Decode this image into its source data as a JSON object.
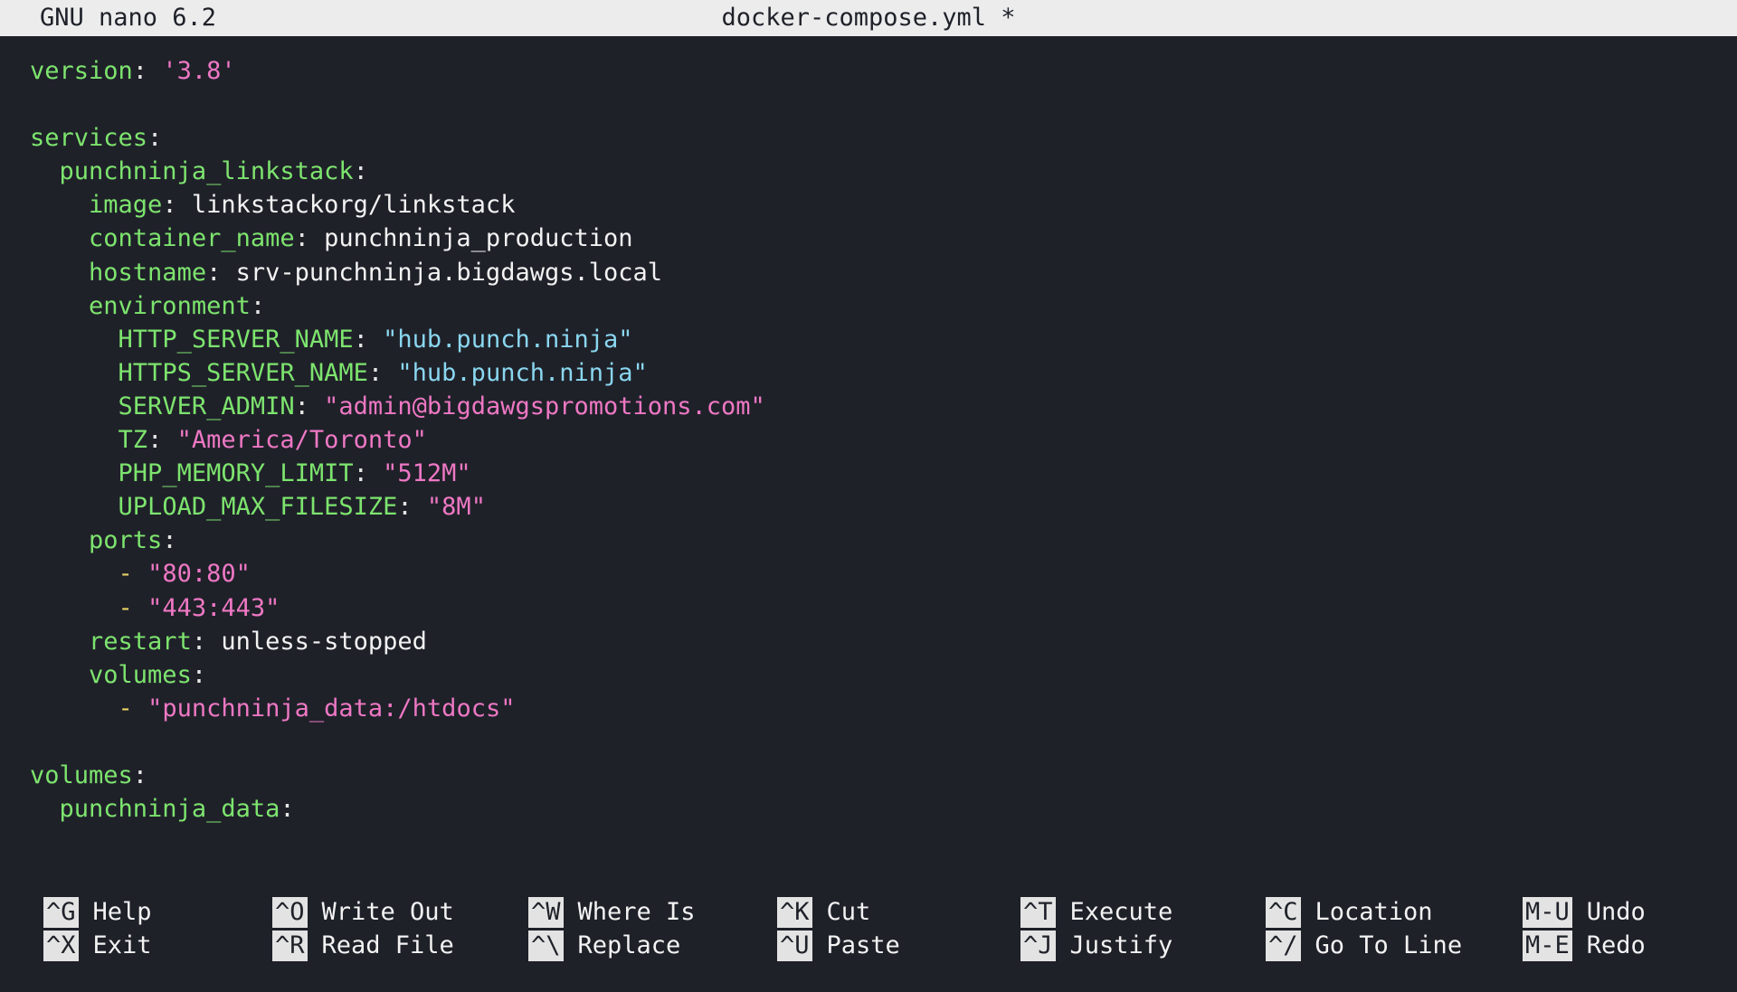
{
  "titlebar": {
    "app": "GNU nano 6.2",
    "filename": "docker-compose.yml *"
  },
  "colors": {
    "background": "#1f2129",
    "key": "#7de46e",
    "string": "#ee78c4",
    "string_alt": "#8ad7f0",
    "dash": "#e8d064",
    "titlebar_bg": "#ececed"
  },
  "editor": {
    "version_key": "version",
    "version_value": "'3.8'",
    "services_key": "services",
    "service_name": "punchninja_linkstack",
    "image_key": "image",
    "image_value": "linkstackorg/linkstack",
    "container_name_key": "container_name",
    "container_name_value": "punchninja_production",
    "hostname_key": "hostname",
    "hostname_value": "srv-punchninja.bigdawgs.local",
    "environment_key": "environment",
    "env": {
      "http_server_name_key": "HTTP_SERVER_NAME",
      "http_server_name_value": "\"hub.punch.ninja\"",
      "https_server_name_key": "HTTPS_SERVER_NAME",
      "https_server_name_value": "\"hub.punch.ninja\"",
      "server_admin_key": "SERVER_ADMIN",
      "server_admin_value": "\"admin@bigdawgspromotions.com\"",
      "tz_key": "TZ",
      "tz_value": "\"America/Toronto\"",
      "php_memory_limit_key": "PHP_MEMORY_LIMIT",
      "php_memory_limit_value": "\"512M\"",
      "upload_max_filesize_key": "UPLOAD_MAX_FILESIZE",
      "upload_max_filesize_value": "\"8M\""
    },
    "ports_key": "ports",
    "port_1": "\"80:80\"",
    "port_2": "\"443:443\"",
    "restart_key": "restart",
    "restart_value": "unless-stopped",
    "volumes_key": "volumes",
    "volume_mount": "\"punchninja_data:/htdocs\"",
    "top_volumes_key": "volumes",
    "volume_name": "punchninja_data"
  },
  "shortcuts": [
    {
      "key": "^G",
      "label": "Help"
    },
    {
      "key": "^X",
      "label": "Exit"
    },
    {
      "key": "^O",
      "label": "Write Out"
    },
    {
      "key": "^R",
      "label": "Read File"
    },
    {
      "key": "^W",
      "label": "Where Is"
    },
    {
      "key": "^\\",
      "label": "Replace"
    },
    {
      "key": "^K",
      "label": "Cut"
    },
    {
      "key": "^U",
      "label": "Paste"
    },
    {
      "key": "^T",
      "label": "Execute"
    },
    {
      "key": "^J",
      "label": "Justify"
    },
    {
      "key": "^C",
      "label": "Location"
    },
    {
      "key": "^/",
      "label": "Go To Line"
    },
    {
      "key": "M-U",
      "label": "Undo"
    },
    {
      "key": "M-E",
      "label": "Redo"
    }
  ]
}
